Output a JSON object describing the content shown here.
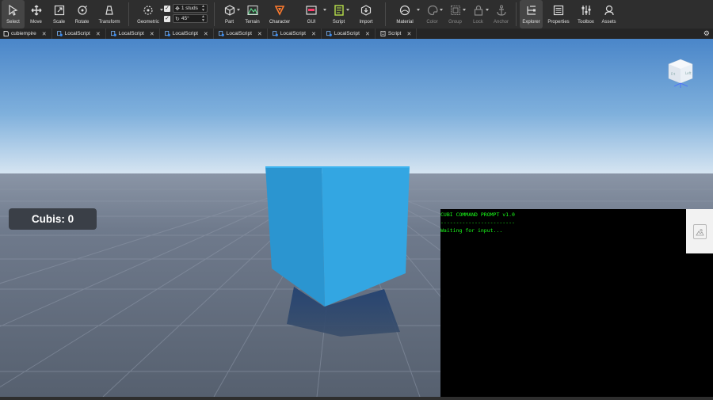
{
  "toolbar": {
    "tools": [
      {
        "label": "Select",
        "icon": "cursor-icon",
        "active": true
      },
      {
        "label": "Move",
        "icon": "move-icon"
      },
      {
        "label": "Scale",
        "icon": "scale-icon"
      },
      {
        "label": "Rotate",
        "icon": "rotate-icon"
      },
      {
        "label": "Transform",
        "icon": "transform-icon"
      },
      {
        "label": "Geometric",
        "icon": "geometric-icon"
      }
    ],
    "snap": {
      "move_value": "1 studs",
      "rotate_value": "45°"
    },
    "insert": [
      {
        "label": "Part",
        "icon": "cube-icon"
      },
      {
        "label": "Terrain",
        "icon": "terrain-icon"
      },
      {
        "label": "Character",
        "icon": "character-icon"
      },
      {
        "label": "GUI",
        "icon": "gui-icon"
      },
      {
        "label": "Script",
        "icon": "script-icon"
      },
      {
        "label": "Import",
        "icon": "import-icon"
      }
    ],
    "edit": [
      {
        "label": "Material",
        "icon": "material-icon"
      },
      {
        "label": "Color",
        "icon": "color-icon",
        "disabled": true
      },
      {
        "label": "Group",
        "icon": "group-icon",
        "disabled": true
      },
      {
        "label": "Lock",
        "icon": "lock-icon",
        "disabled": true
      },
      {
        "label": "Anchor",
        "icon": "anchor-icon",
        "disabled": true
      }
    ],
    "panels": [
      {
        "label": "Explorer",
        "icon": "explorer-icon"
      },
      {
        "label": "Properties",
        "icon": "properties-icon"
      },
      {
        "label": "Toolbox",
        "icon": "toolbox-icon"
      },
      {
        "label": "Assets",
        "icon": "assets-icon"
      }
    ]
  },
  "tabs": [
    {
      "label": "cubiempire",
      "type": "place"
    },
    {
      "label": "LocalScript",
      "type": "script"
    },
    {
      "label": "LocalScript",
      "type": "script"
    },
    {
      "label": "LocalScript",
      "type": "script"
    },
    {
      "label": "LocalScript",
      "type": "script"
    },
    {
      "label": "LocalScript",
      "type": "script"
    },
    {
      "label": "LocalScript",
      "type": "script"
    },
    {
      "label": "Script",
      "type": "server-script"
    }
  ],
  "game": {
    "cubis_label": "Cubis: 0"
  },
  "console": {
    "lines": [
      "CUBI COMMAND PROMPT v1.0",
      "------------------------",
      "Waiting for input..."
    ],
    "text_color": "#1aff1a"
  },
  "colors": {
    "sky_top": "#4a86c9",
    "sky_horizon": "#d8e6f2",
    "cube": "#2ea2de",
    "ground": "#5c6576"
  }
}
